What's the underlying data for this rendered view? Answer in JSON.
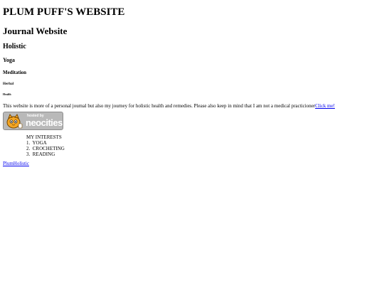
{
  "headings": {
    "h1": "PLUM PUFF'S WEBSITE",
    "h2": "Journal Website",
    "h3": "Holistic",
    "h4": "Yoga",
    "h5": "Meditation",
    "h6": "Herbal",
    "h7": "Health"
  },
  "intro": {
    "text": "This website is more of a personal journal but also my journey for holistic health and remedies. Please also keep in mind that I am not a medical practicioner",
    "link_label": "Click me!"
  },
  "badge": {
    "hosted_text": "hosted by",
    "brand_text": "neocities",
    "icon": "neocities-cat-icon",
    "colors": {
      "background": "#b9b9b9",
      "text": "#ffffff"
    }
  },
  "interests": {
    "title": "MY INTERESTS",
    "items": [
      {
        "num": "1.",
        "label": "YOGA"
      },
      {
        "num": "2.",
        "label": "CROCHETING"
      },
      {
        "num": "3.",
        "label": "READING"
      }
    ]
  },
  "footer": {
    "link_label": "PlumHolistic"
  },
  "colors": {
    "link": "#0000ee",
    "text": "#000000",
    "background": "#ffffff"
  }
}
